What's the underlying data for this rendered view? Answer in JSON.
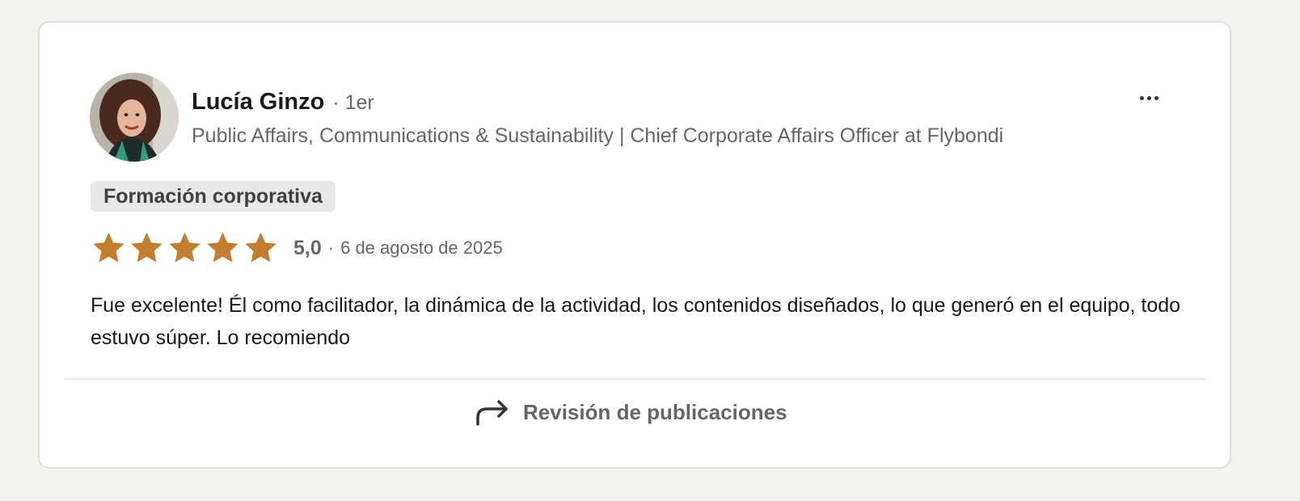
{
  "reviewer": {
    "name": "Lucía Ginzo",
    "degree": "· 1er",
    "headline": "Public Affairs, Communications & Sustainability | Chief Corporate Affairs Officer at Flybondi",
    "avatar_icon": "profile-photo"
  },
  "menu": {
    "icon": "more-horizontal-icon"
  },
  "service_tag": "Formación corporativa",
  "rating": {
    "stars": 5,
    "max_stars": 5,
    "star_color": "#c37d2e",
    "score": "5,0",
    "separator": "·",
    "date": "6 de agosto de 2025"
  },
  "review": {
    "text": "Fue excelente! Él como facilitador, la dinámica de la actividad, los contenidos diseñados, lo que generó en el equipo, todo estuvo súper. Lo recomiendo"
  },
  "footer": {
    "icon": "share-arrow-icon",
    "label": "Revisión de publicaciones"
  }
}
